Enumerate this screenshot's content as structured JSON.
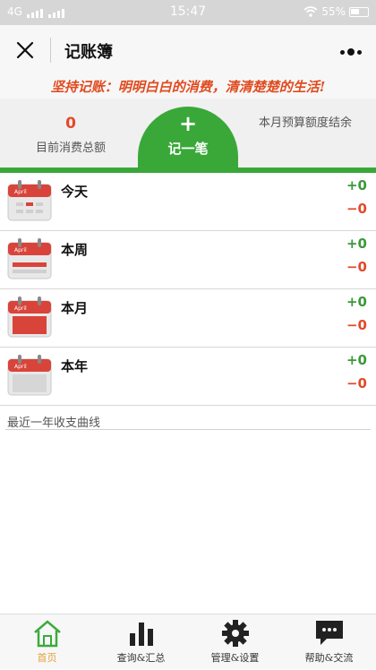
{
  "status_bar": {
    "network": "4G",
    "time": "15:47",
    "battery": "55%"
  },
  "header": {
    "title": "记账簿"
  },
  "slogan": "坚持记账：明明白白的消费，清清楚楚的生活!",
  "summary": {
    "total_value": "0",
    "total_label": "目前消费总额",
    "budget_label": "本月预算额度结余",
    "record_plus": "+",
    "record_label": "记一笔"
  },
  "periods": [
    {
      "label": "今天",
      "income": "+0",
      "expense": "−0",
      "icon": "calendar-icon",
      "month": "April"
    },
    {
      "label": "本周",
      "income": "+0",
      "expense": "−0",
      "icon": "calendar-week-icon",
      "month": "April"
    },
    {
      "label": "本月",
      "income": "+0",
      "expense": "−0",
      "icon": "calendar-month-icon",
      "month": "April"
    },
    {
      "label": "本年",
      "income": "+0",
      "expense": "−0",
      "icon": "calendar-year-icon",
      "month": "April"
    }
  ],
  "curve_title": "最近一年收支曲线",
  "tabs": [
    {
      "label": "首页",
      "icon": "home-icon"
    },
    {
      "label": "查询&汇总",
      "icon": "bar-chart-icon"
    },
    {
      "label": "管理&设置",
      "icon": "gear-icon"
    },
    {
      "label": "帮助&交流",
      "icon": "chat-icon"
    }
  ],
  "colors": {
    "accent": "#39a839",
    "income": "#3a9a3a",
    "expense": "#e04a2a",
    "slogan": "#e04b1f",
    "active_tab": "#e2a23b"
  }
}
